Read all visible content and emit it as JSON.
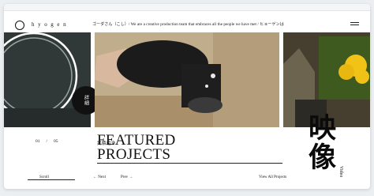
{
  "header": {
    "logo": "hyogen",
    "ticker": "ゴーダさん（こし）/ We are a creative production team that embraces all the people we have met / ヒョーゲンは"
  },
  "hero": {
    "detail_badge": "詳細"
  },
  "projects": {
    "pagination": [
      "01",
      "/",
      "05"
    ],
    "label_jp": "実績紹介",
    "title_line1": "FEATURED",
    "title_line2": "PROJECTS",
    "scroll": "Scroll",
    "next": "Next",
    "prev": "Prev",
    "view_all": "View All Projects"
  },
  "side": {
    "heading_jp": "映像",
    "label": "Video"
  },
  "colors": {
    "background": "#eceff1",
    "frame": "#ffffff",
    "text": "#111111"
  }
}
